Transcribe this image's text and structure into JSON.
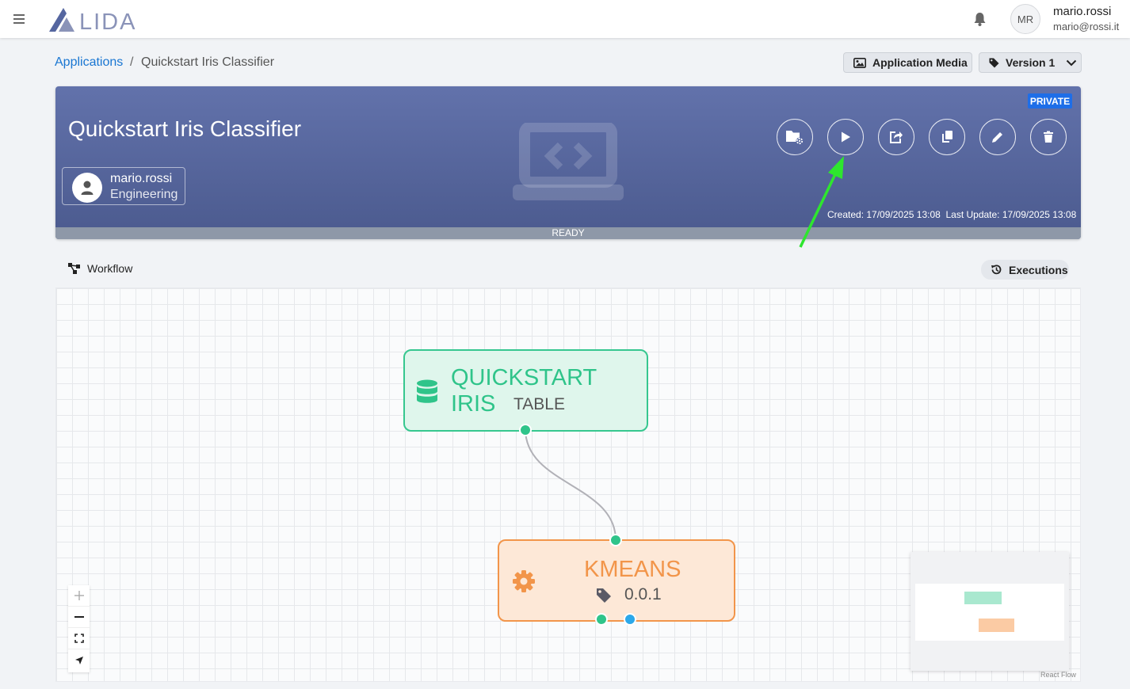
{
  "topbar": {
    "logo_text": "LIDA",
    "avatar_initials": "MR",
    "user_name": "mario.rossi",
    "user_email": "mario@rossi.it"
  },
  "breadcrumb": {
    "parent": "Applications",
    "separator": "/",
    "current": "Quickstart Iris Classifier"
  },
  "actions": {
    "media_label": "Application Media",
    "version_label": "Version 1"
  },
  "app": {
    "title": "Quickstart Iris Classifier",
    "owner_name": "mario.rossi",
    "owner_team": "Engineering",
    "visibility": "PRIVATE",
    "created_label": "Created:",
    "created_value": "17/09/2025 13:08",
    "updated_label": "Last Update:",
    "updated_value": "17/09/2025 13:08",
    "status": "READY",
    "buttons": [
      "folder-settings-icon",
      "play-icon",
      "share-icon",
      "copy-icon",
      "edit-icon",
      "delete-icon"
    ]
  },
  "workflow": {
    "label": "Workflow",
    "executions_label": "Executions",
    "nodes": [
      {
        "title": "QUICKSTART IRIS",
        "subtitle": "TABLE",
        "icon": "database-icon",
        "color": "#36c78f"
      },
      {
        "title": "KMEANS",
        "subtitle": "0.0.1",
        "icon": "gear-icon",
        "color": "#f2954a"
      }
    ],
    "attribution": "React Flow"
  },
  "colors": {
    "accent": "#1976d2",
    "hero": "#5566a0",
    "private_badge": "#1e6ee8",
    "dataset_node": "#36c78f",
    "service_node": "#f2954a",
    "handle_blue": "#2ba8ea"
  }
}
